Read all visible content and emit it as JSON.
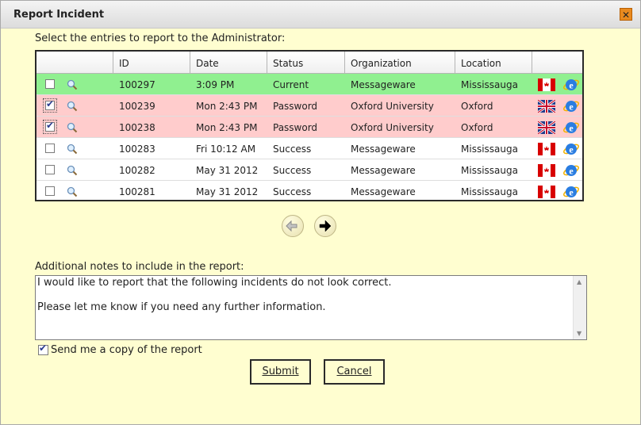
{
  "dialog": {
    "title": "Report Incident",
    "close_label": "✕"
  },
  "select_label": "Select the entries to report to the Administrator:",
  "columns": [
    "ID",
    "Date",
    "Status",
    "Organization",
    "Location"
  ],
  "rows": [
    {
      "id": "100297",
      "date": "3:09 PM",
      "status": "Current",
      "org": "Messageware",
      "location": "Mississauga",
      "checked": false,
      "flag": "canada-flag-icon"
    },
    {
      "id": "100239",
      "date": "Mon 2:43 PM",
      "status": "Password",
      "org": "Oxford University",
      "location": "Oxford",
      "checked": true,
      "flag": "uk-flag-icon"
    },
    {
      "id": "100238",
      "date": "Mon 2:43 PM",
      "status": "Password",
      "org": "Oxford University",
      "location": "Oxford",
      "checked": true,
      "flag": "uk-flag-icon"
    },
    {
      "id": "100283",
      "date": "Fri 10:12 AM",
      "status": "Success",
      "org": "Messageware",
      "location": "Mississauga",
      "checked": false,
      "flag": "canada-flag-icon"
    },
    {
      "id": "100282",
      "date": "May 31 2012",
      "status": "Success",
      "org": "Messageware",
      "location": "Mississauga",
      "checked": false,
      "flag": "canada-flag-icon"
    },
    {
      "id": "100281",
      "date": "May 31 2012",
      "status": "Success",
      "org": "Messageware",
      "location": "Mississauga",
      "checked": false,
      "flag": "canada-flag-icon"
    }
  ],
  "notes_label": "Additional notes to include in the report:",
  "notes": {
    "line1": "I would like to report that the following incidents do not look correct.",
    "line2": "Please let me know if you need any further information."
  },
  "copy_label": "Send me a copy of the report",
  "copy_checked": true,
  "buttons": {
    "submit": "Submit",
    "cancel": "Cancel"
  },
  "colors": {
    "current_row": "#90f090",
    "password_row": "#ffcccc",
    "background": "#fffed0"
  }
}
